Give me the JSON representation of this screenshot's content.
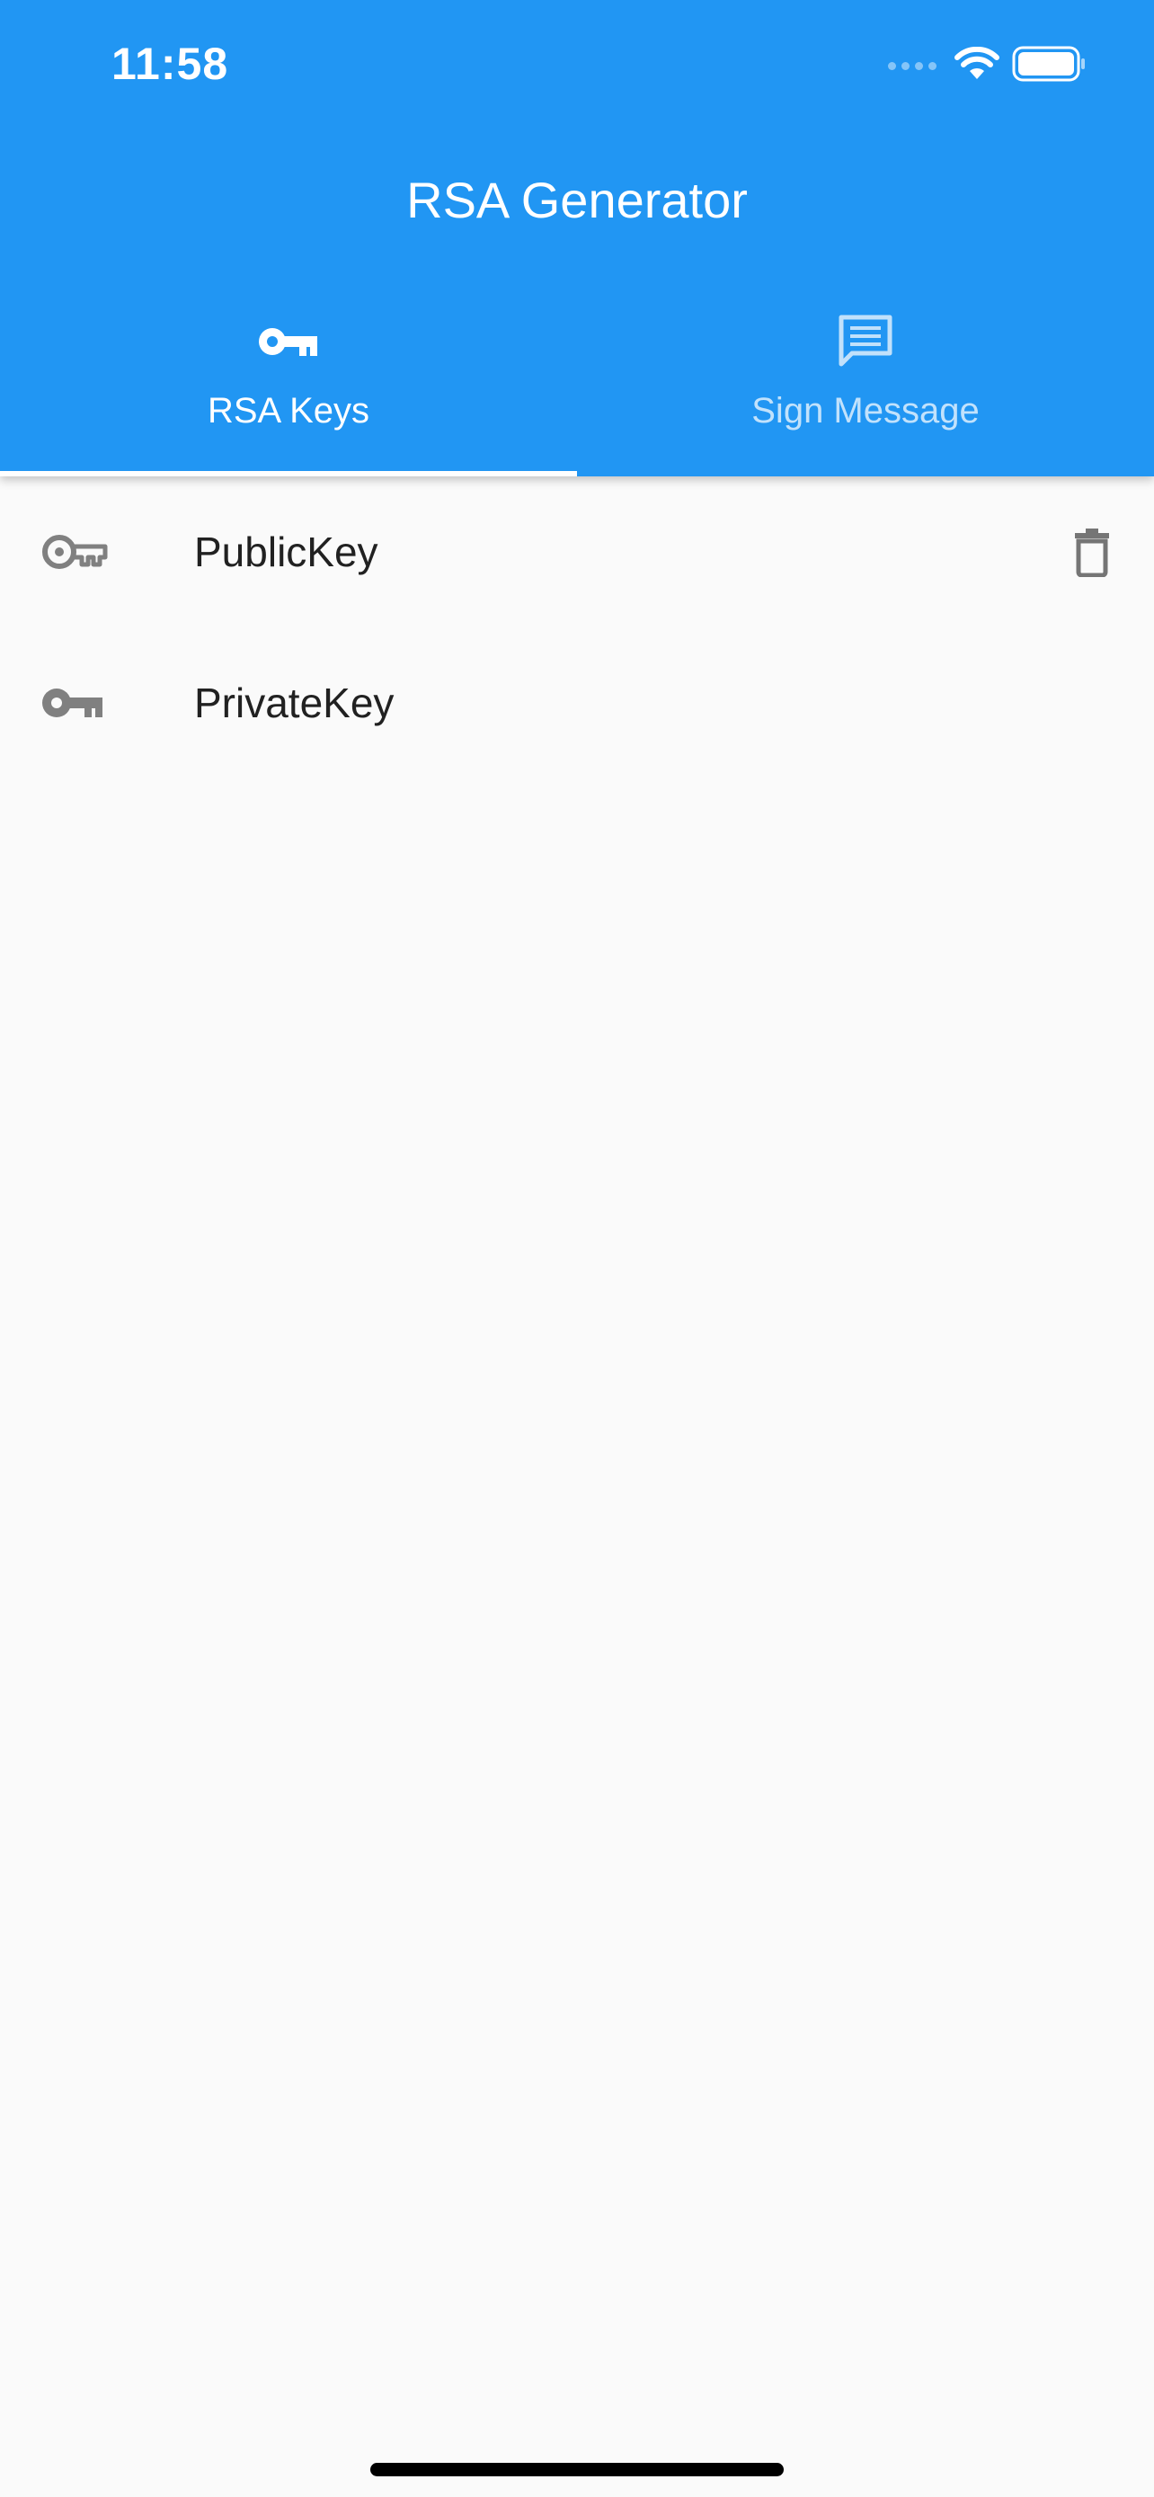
{
  "status_bar": {
    "time": "11:58",
    "wifi_icon": "wifi-icon",
    "battery_icon": "battery-icon"
  },
  "app_bar": {
    "title": "RSA Generator",
    "background_color": "#2196f3"
  },
  "tabs": [
    {
      "label": "RSA Keys",
      "icon": "key-icon",
      "selected": true
    },
    {
      "label": "Sign Message",
      "icon": "message-icon",
      "selected": false
    }
  ],
  "keys_list": [
    {
      "label": "PublicKey",
      "icon": "key-outline-icon",
      "action_icon": "delete-icon"
    },
    {
      "label": "PrivateKey",
      "icon": "key-filled-icon"
    }
  ]
}
